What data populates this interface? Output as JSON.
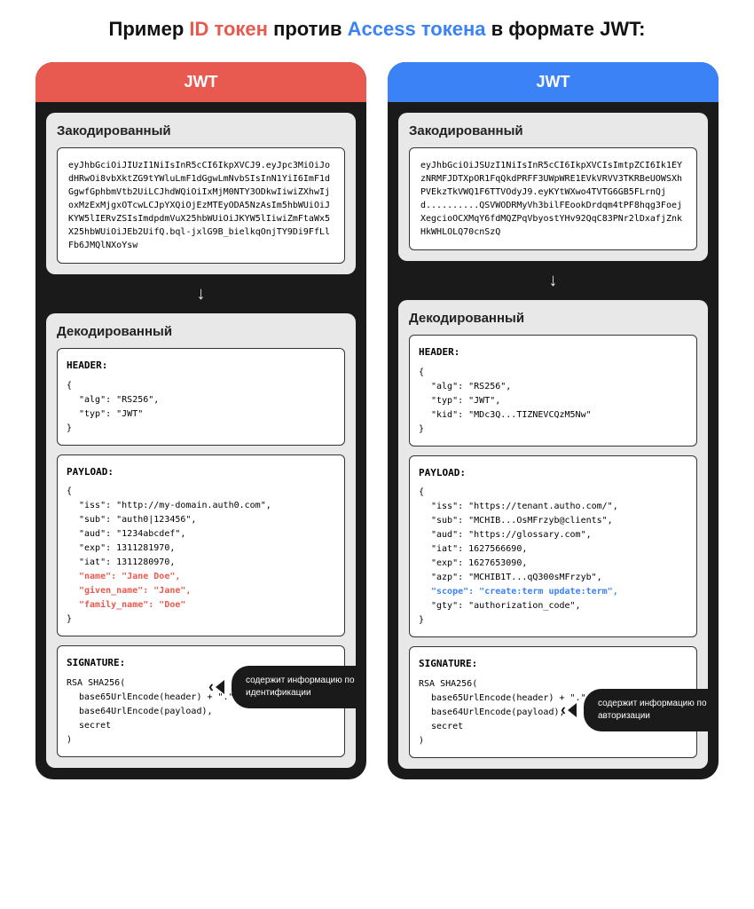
{
  "title": {
    "prefix": "Пример ",
    "id": "ID токен",
    "mid": " против ",
    "access": "Access токена",
    "suffix": " в формате JWT:"
  },
  "left": {
    "header": "JWT",
    "encoded_label": "Закодированный",
    "encoded": "eyJhbGciOiJIUzI1NiIsInR5cCI6IkpXVCJ9.eyJpc3MiOiJodHRwOi8vbXktZG9tYWluLmF1dGgwLmNvbSIsInN1YiI6ImF1dGgwfGphbmVtb2UiLCJhdWQiOiIxMjM0NTY3ODkwIiwiZXhwIjoxMzExMjgxOTcwLCJpYXQiOjEzMTEyODA5NzAsIm5hbWUiOiJKYW5lIERvZSIsImdpdmVuX25hbWUiOiJKYW5lIiwiZmFtaWx5X25hbWUiOiJEb2UifQ.bql-jxlG9B_bielkqOnjTY9Di9FfLlFb6JMQlNXoYsw",
    "decoded_label": "Декодированный",
    "header_label": "HEADER:",
    "header_json": {
      "alg": "\"alg\": \"RS256\",",
      "typ": "\"typ\": \"JWT\""
    },
    "payload_label": "PAYLOAD:",
    "payload": {
      "iss": "\"iss\": \"http://my-domain.auth0.com\",",
      "sub": "\"sub\": \"auth0|123456\",",
      "aud": "\"aud\": \"1234abcdef\",",
      "exp": "\"exp\": 1311281970,",
      "iat": "\"iat\": 1311280970,",
      "name": "\"name\": \"Jane Doe\",",
      "given": "\"given_name\": \"Jane\",",
      "family": "\"family_name\": \"Doe\""
    },
    "tooltip": "содержит информацию по идентификации",
    "sig_label": "SIGNATURE:",
    "sig": {
      "l1": "RSA SHA256(",
      "l2": "base65UrlEncode(header) + \".\" +",
      "l3": "base64UrlEncode(payload),",
      "l4": "secret",
      "l5": ")"
    }
  },
  "right": {
    "header": "JWT",
    "encoded_label": "Закодированный",
    "encoded": "eyJhbGciOiJSUzI1NiIsInR5cCI6IkpXVCIsImtpZCI6Ik1EYzNRMFJDTXpOR1FqQkdPRFF3UWpWRE1EVkVRVV3TKRBeUOWSXhPVEkzTkVWQ1F6TTVOdyJ9.eyKYtWXwo4TVTG6GB5FLrnQjd..........QSVWODRMyVh3bilFEookDrdqm4tPF8hqg3FoejXegcioOCXMqY6fdMQZPqVbyostYHv92QqC83PNr2lDxafjZnkHkWHLOLQ70cnSzQ",
    "decoded_label": "Декодированный",
    "header_label": "HEADER:",
    "header_json": {
      "alg": "\"alg\": \"RS256\",",
      "typ": "\"typ\": \"JWT\",",
      "kid": "\"kid\": \"MDc3Q...TIZNEVCQzM5Nw\""
    },
    "payload_label": "PAYLOAD:",
    "payload": {
      "iss": "\"iss\": \"https://tenant.autho.com/\",",
      "sub": "\"sub\": \"MCHIB...OsMFrzyb@clients\",",
      "aud": "\"aud\": \"https://glossary.com\",",
      "iat": "\"iat\": 1627566690,",
      "exp": "\"exp\": 1627653090,",
      "azp": "\"azp\": \"MCHIB1T...qQ300sMFrzyb\",",
      "scope": "\"scope\": \"create:term update:term\",",
      "gty": "\"gty\": \"authorization_code\","
    },
    "tooltip": "содержит информацию по авторизации",
    "sig_label": "SIGNATURE:",
    "sig": {
      "l1": "RSA SHA256(",
      "l2": "base65UrlEncode(header) + \".\" +",
      "l3": "base64UrlEncode(payload),",
      "l4": "secret",
      "l5": ")"
    }
  }
}
